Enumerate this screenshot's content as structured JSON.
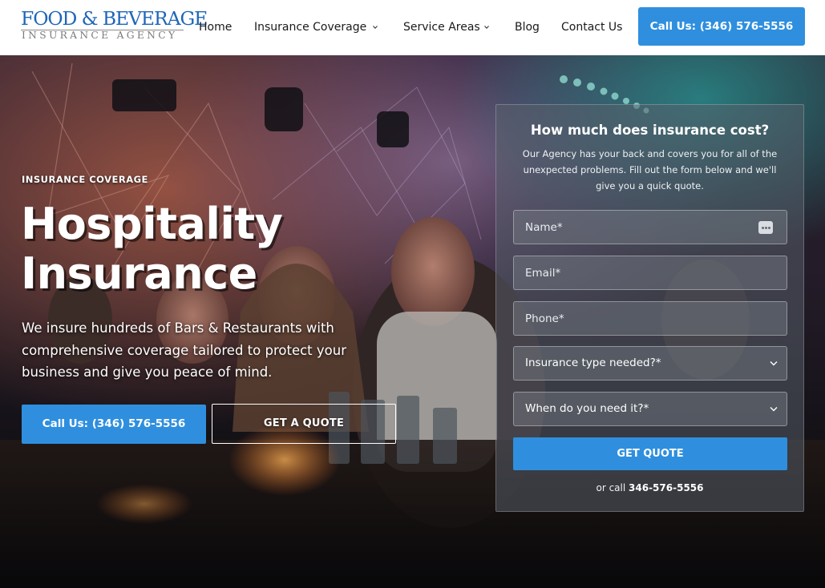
{
  "header": {
    "logo_line1": "FOOD & BEVERAGE",
    "logo_line2": "INSURANCE AGENCY",
    "nav": [
      {
        "label": "Home"
      },
      {
        "label": "Insurance Coverage",
        "has_dropdown": true
      },
      {
        "label": "Service Areas",
        "has_dropdown": true
      },
      {
        "label": "Blog"
      },
      {
        "label": "Contact Us"
      }
    ],
    "call_button": "Call Us: (346) 576-5556"
  },
  "hero": {
    "eyebrow": "INSURANCE COVERAGE",
    "title_line1": "Hospitality",
    "title_line2": "Insurance",
    "description": "We insure hundreds of Bars & Restaurants with comprehensive coverage tailored to protect your business and give you peace of mind.",
    "call_button": "Call Us: (346) 576-5556",
    "quote_button": "GET A QUOTE"
  },
  "form": {
    "title": "How much does insurance cost?",
    "description": "Our Agency has your back and covers you for all of the unexpected problems. Fill out the form below and we'll give you a quick quote.",
    "name_placeholder": "Name*",
    "email_placeholder": "Email*",
    "phone_placeholder": "Phone*",
    "insurance_type_selected": "Insurance type needed?*",
    "timing_selected": "When do you need it?*",
    "submit_label": "GET QUOTE",
    "or_call_prefix": "or call",
    "or_call_phone": "346-576-5556"
  },
  "colors": {
    "accent": "#2f8fde",
    "logo_blue": "#1f66b8",
    "header_bg": "#ffffff",
    "nav_text": "#1a1a1a"
  },
  "icons": {
    "nav_dropdown": "chevron-down-icon",
    "select_dropdown": "chevron-down-icon",
    "password_manager": "password-manager-icon"
  }
}
